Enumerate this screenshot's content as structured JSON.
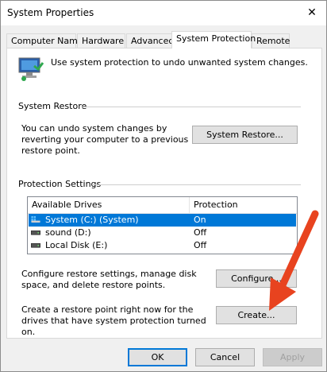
{
  "window": {
    "title": "System Properties"
  },
  "tabs": [
    {
      "label": "Computer Name"
    },
    {
      "label": "Hardware"
    },
    {
      "label": "Advanced"
    },
    {
      "label": "System Protection"
    },
    {
      "label": "Remote"
    }
  ],
  "intro": {
    "text": "Use system protection to undo unwanted system changes."
  },
  "restore": {
    "group_label": "System Restore",
    "description": "You can undo system changes by reverting your computer to a previous restore point.",
    "button_label": "System Restore..."
  },
  "protection": {
    "group_label": "Protection Settings",
    "columns": [
      "Available Drives",
      "Protection"
    ],
    "drives": [
      {
        "name": "System (C:) (System)",
        "status": "On",
        "icon": "system-drive-icon"
      },
      {
        "name": "sound (D:)",
        "status": "Off",
        "icon": "drive-icon"
      },
      {
        "name": "Local Disk (E:)",
        "status": "Off",
        "icon": "drive-icon"
      }
    ],
    "configure_text": "Configure restore settings, manage disk space, and delete restore points.",
    "configure_button": "Configure...",
    "create_text": "Create a restore point right now for the drives that have system protection turned on.",
    "create_button": "Create..."
  },
  "footer": {
    "ok": "OK",
    "cancel": "Cancel",
    "apply": "Apply"
  },
  "colors": {
    "accent": "#0078d7",
    "arrow": "#e8431f"
  }
}
